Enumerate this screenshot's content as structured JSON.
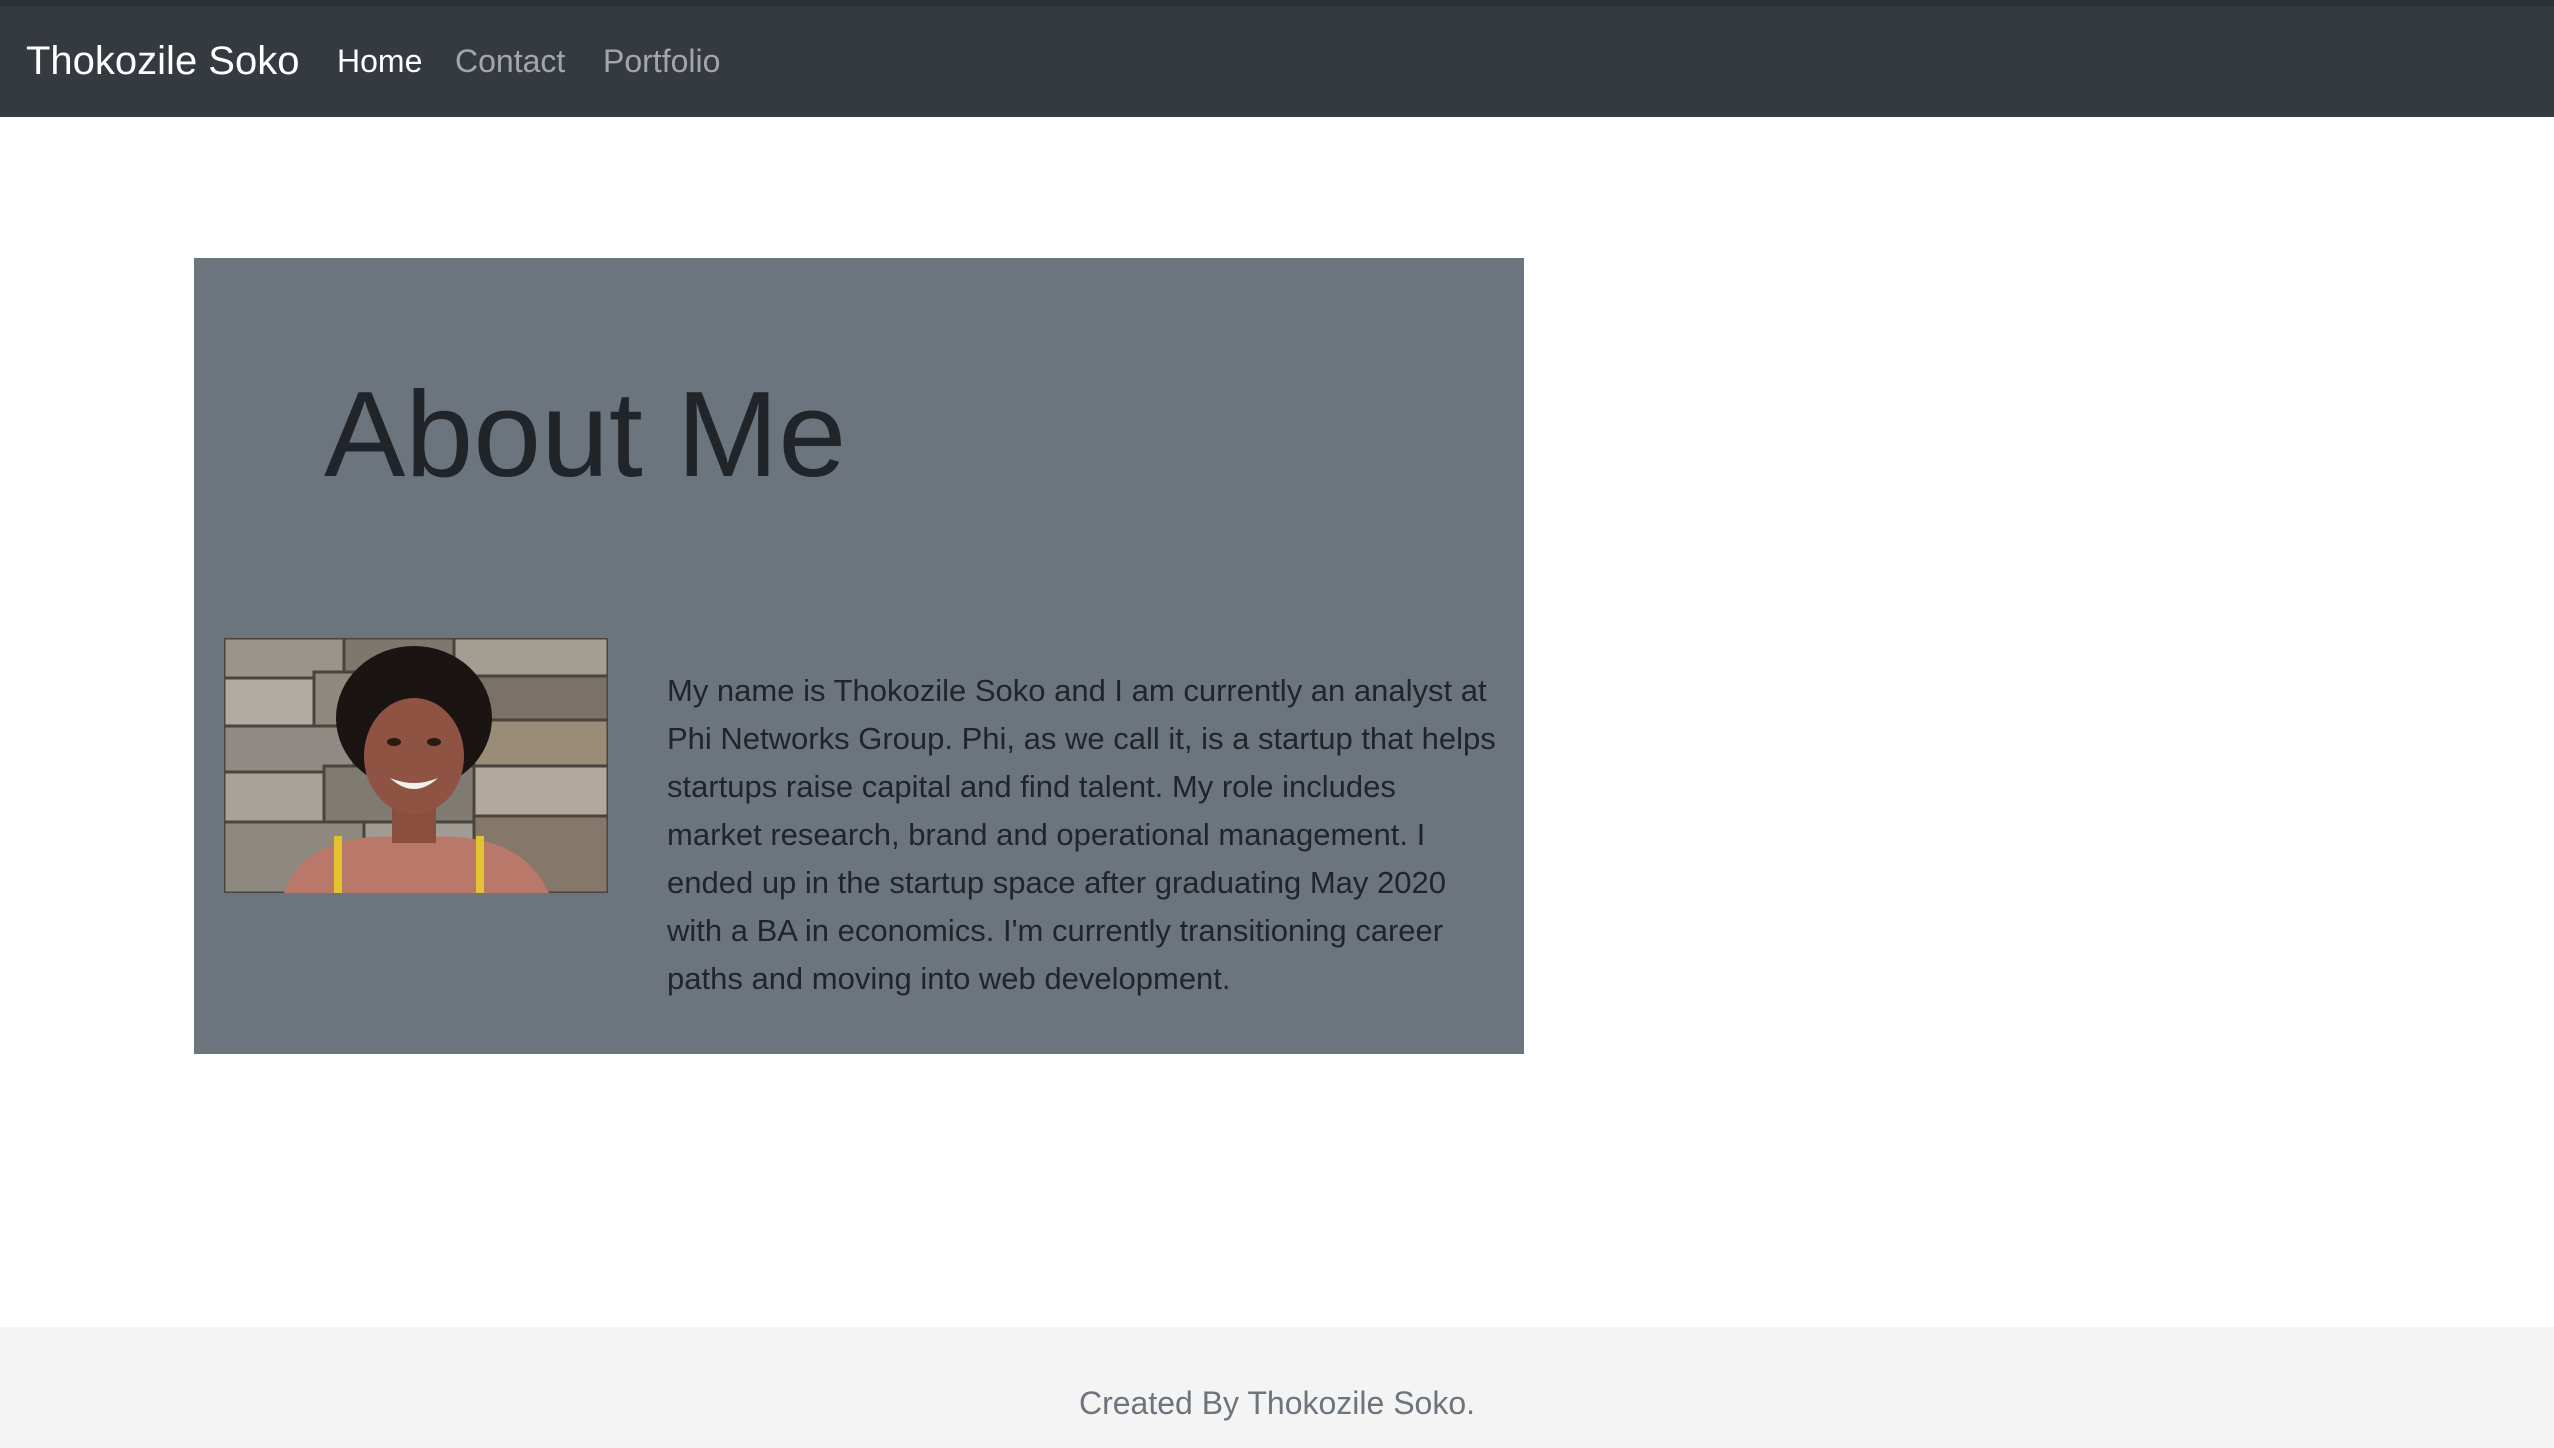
{
  "navbar": {
    "brand": "Thokozile Soko",
    "links": [
      {
        "label": "Home",
        "active": true
      },
      {
        "label": "Contact",
        "active": false
      },
      {
        "label": "Portfolio",
        "active": false
      }
    ]
  },
  "about": {
    "heading": "About Me",
    "bio": "My name is Thokozile Soko and I am currently an analyst at Phi Networks Group. Phi, as we call it, is a startup that helps startups raise capital and find talent. My role includes market research, brand and operational management. I ended up in the startup space after graduating May 2020 with a BA in economics. I'm currently transitioning career paths and moving into web development.",
    "photo_icon": "profile-photo"
  },
  "footer": {
    "text": "Created By Thokozile Soko."
  },
  "colors": {
    "navbar_bg": "#343a40",
    "jumbotron_bg": "#6c757d",
    "footer_bg": "#f4f4f4",
    "text_dark": "#212529",
    "muted": "#6c757d"
  }
}
